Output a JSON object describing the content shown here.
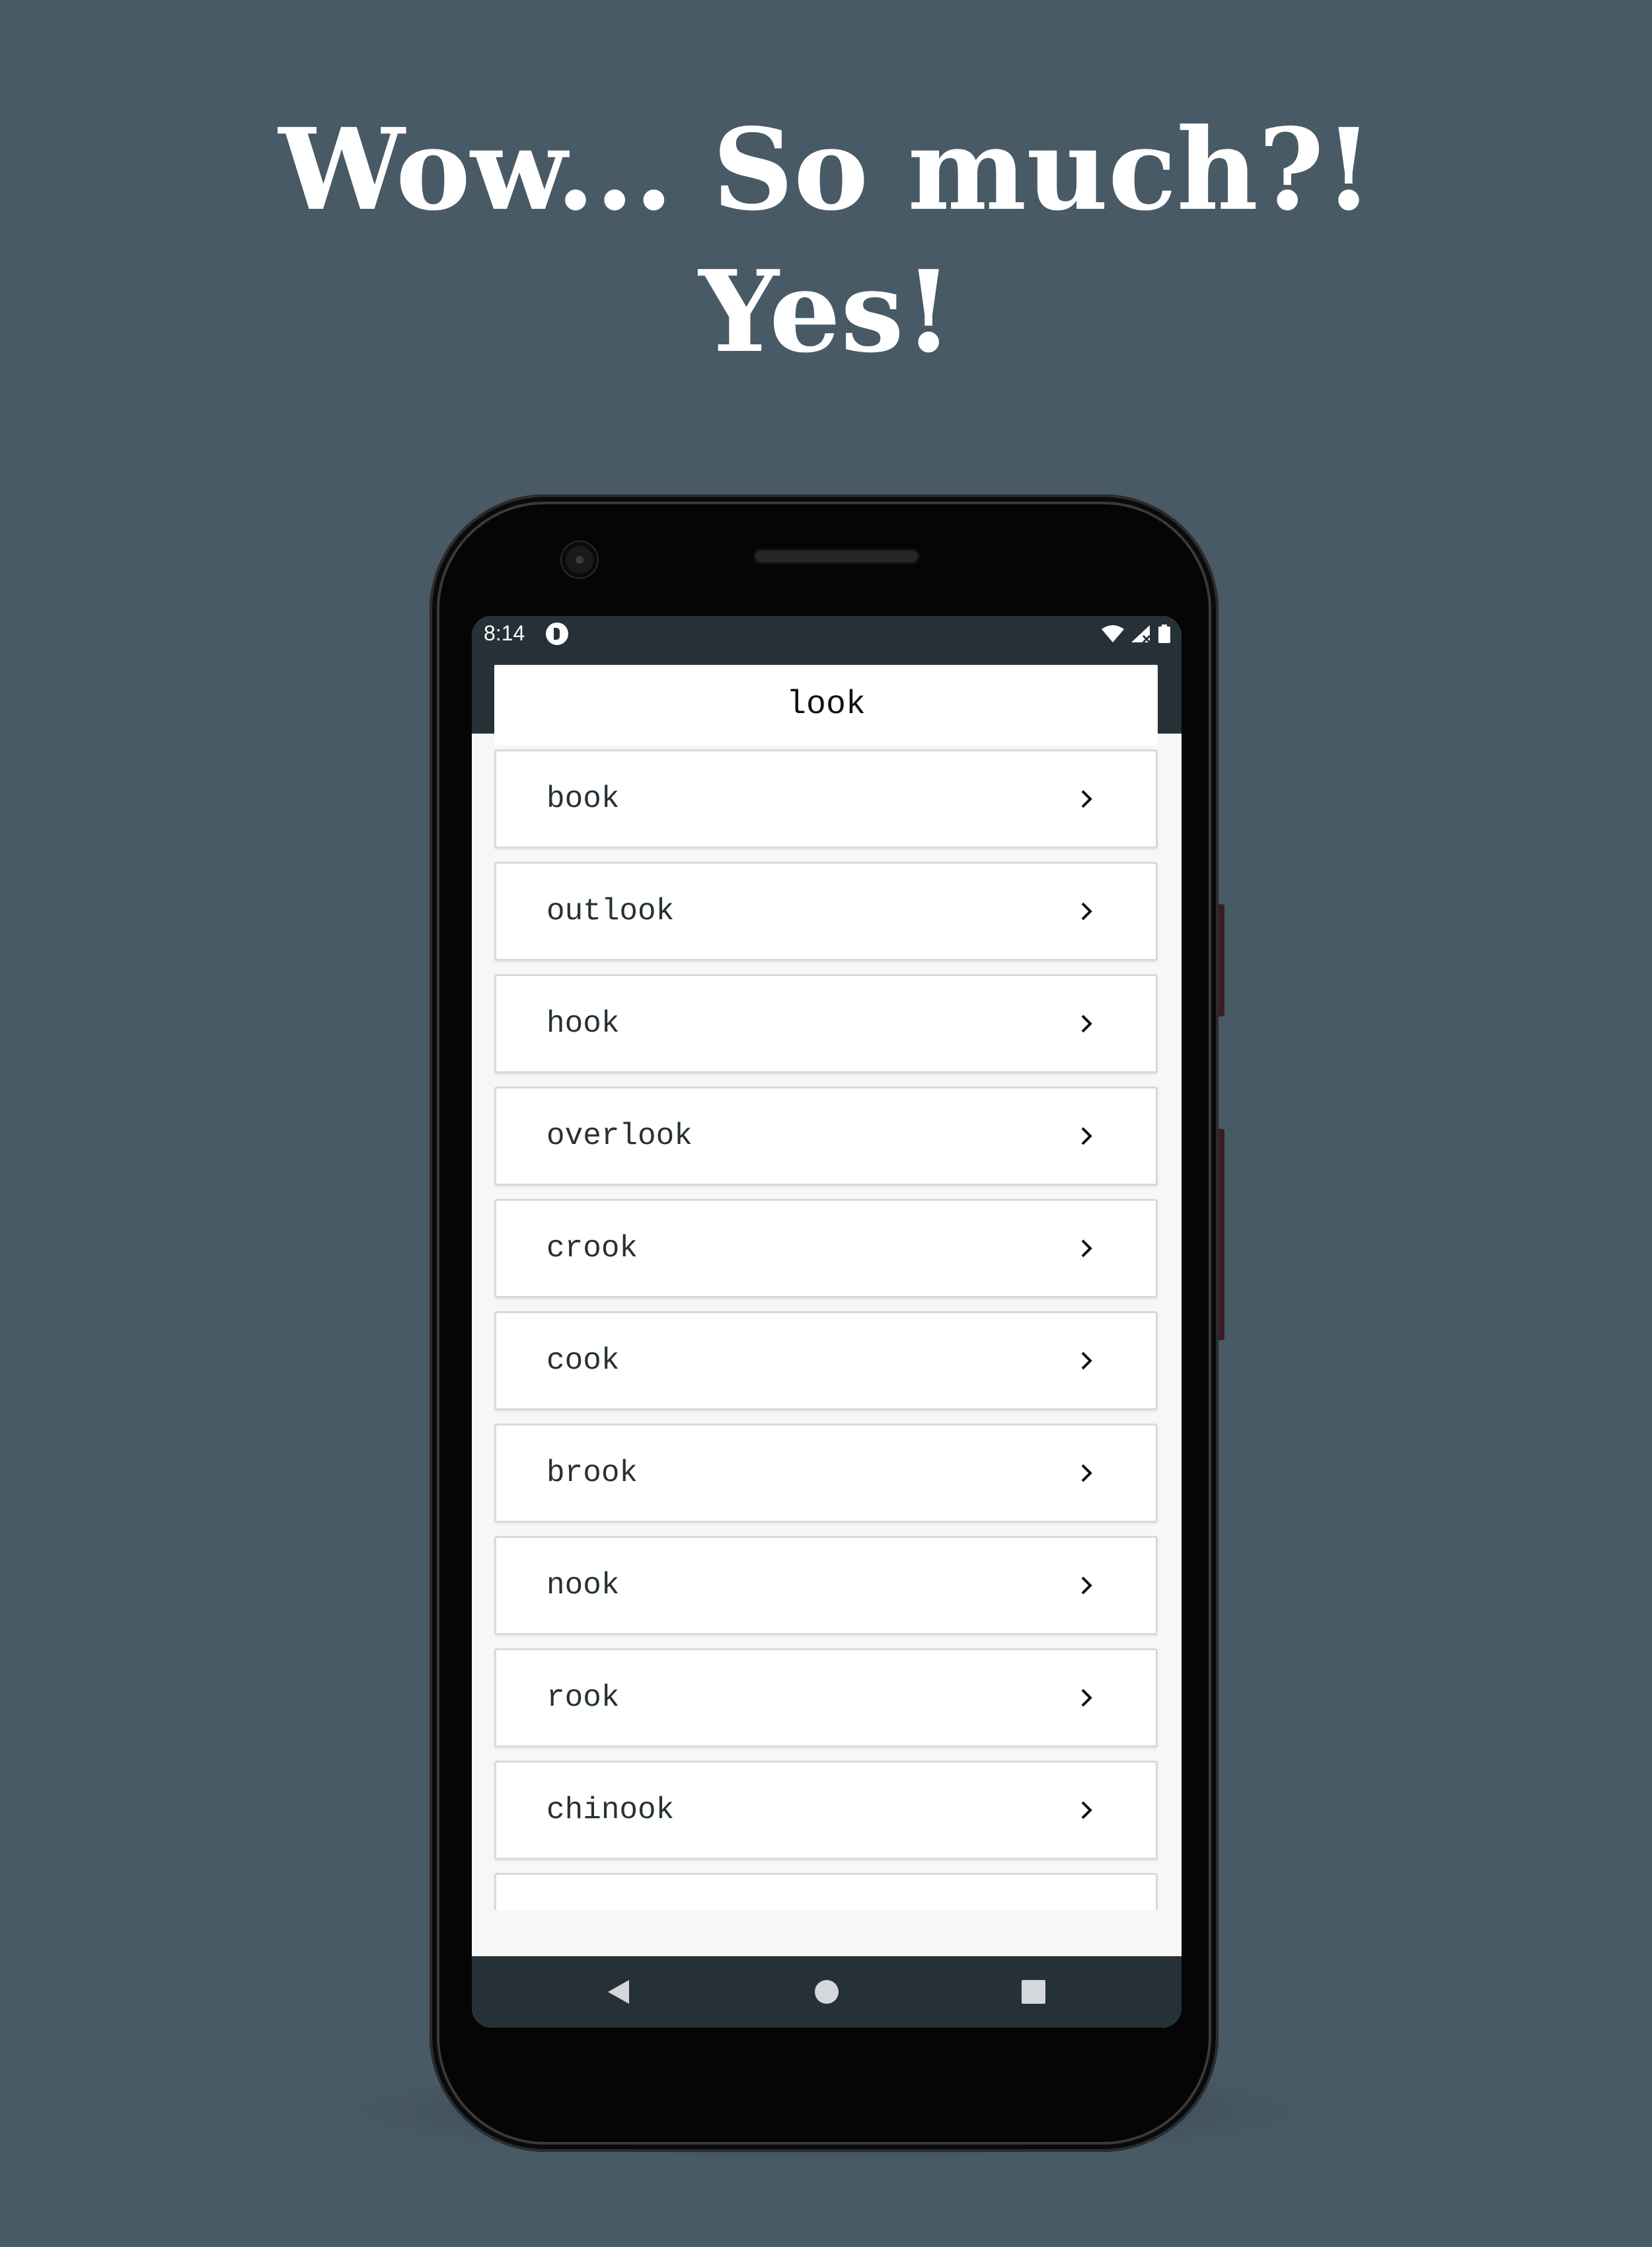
{
  "promo": {
    "headline_line1": "Wow... So much?!",
    "headline_line2": "Yes!"
  },
  "status_bar": {
    "time": "8:14",
    "icons": [
      "app-notification-icon",
      "wifi-icon",
      "signal-icon",
      "battery-icon"
    ]
  },
  "search": {
    "value": "look"
  },
  "results": [
    {
      "label": "book"
    },
    {
      "label": "outlook"
    },
    {
      "label": "hook"
    },
    {
      "label": "overlook"
    },
    {
      "label": "crook"
    },
    {
      "label": "cook"
    },
    {
      "label": "brook"
    },
    {
      "label": "nook"
    },
    {
      "label": "rook"
    },
    {
      "label": "chinook"
    }
  ],
  "nav_bar": {
    "icons": [
      "back-icon",
      "home-icon",
      "recents-icon"
    ]
  },
  "colors": {
    "background": "#485a66",
    "app_bar": "#263137",
    "list_background": "#f7f7f7",
    "card": "#ffffff",
    "card_border": "#d9d9d9",
    "text": "#263137"
  }
}
